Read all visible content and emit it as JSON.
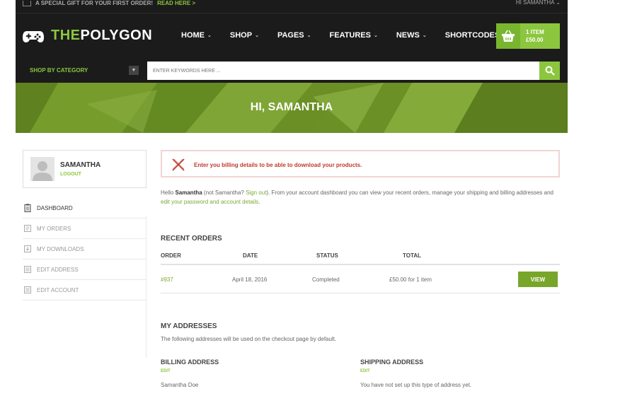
{
  "topbar": {
    "promo": "A SPECIAL GIFT FOR YOUR FIRST ORDER!",
    "promo_link": "READ HERE >",
    "account": "HI SAMANTHA",
    "account_chevron": "⌄"
  },
  "header": {
    "logo_the": "THE",
    "logo_rest": "POLYGON",
    "nav": [
      {
        "label": "HOME"
      },
      {
        "label": "SHOP"
      },
      {
        "label": "PAGES"
      },
      {
        "label": "FEATURES"
      },
      {
        "label": "NEWS"
      },
      {
        "label": "SHORTCODES"
      }
    ],
    "nav_chevron": "⌄",
    "cart": {
      "items": "1 ITEM",
      "total": "£50.00"
    }
  },
  "search": {
    "category_label": "SHOP BY CATEGORY",
    "placeholder": "ENTER KEYWORDS HERE ..."
  },
  "banner": {
    "title": "HI, SAMANTHA"
  },
  "profile": {
    "name": "SAMANTHA",
    "logout": "LOGOUT"
  },
  "menu": [
    {
      "label": "DASHBOARD",
      "icon": "clipboard-icon",
      "active": true
    },
    {
      "label": "MY ORDERS",
      "icon": "orders-icon",
      "active": false
    },
    {
      "label": "MY DOWNLOADS",
      "icon": "download-icon",
      "active": false
    },
    {
      "label": "EDIT ADDRESS",
      "icon": "address-icon",
      "active": false
    },
    {
      "label": "EDIT ACCOUNT",
      "icon": "account-icon",
      "active": false
    }
  ],
  "alert": {
    "message": "Enter you billing details to be able to download your products."
  },
  "intro": {
    "hello": "Hello ",
    "name": "Samantha",
    "not": " (not Samantha? ",
    "signout": "Sign out",
    "rest": "). From your account dashboard you can view your recent orders, manage your shipping and billing addresses and ",
    "edit_link": "edit your password and account details",
    "end": "."
  },
  "recent_orders": {
    "title": "RECENT ORDERS",
    "columns": [
      "ORDER",
      "DATE",
      "STATUS",
      "TOTAL"
    ],
    "rows": [
      {
        "order": "#937",
        "date": "April 18, 2016",
        "status": "Completed",
        "total": "£50.00 for 1 item",
        "action": "VIEW"
      }
    ]
  },
  "addresses": {
    "title": "MY ADDRESSES",
    "note": "The following addresses will be used on the checkout page by default.",
    "billing": {
      "title": "BILLING ADDRESS",
      "edit": "EDIT",
      "value": "Samantha Doe"
    },
    "shipping": {
      "title": "SHIPPING ADDRESS",
      "edit": "EDIT",
      "value": "You have not set up this type of address yet."
    }
  },
  "colors": {
    "accent": "#8cc63f",
    "dark": "#1b1b1b",
    "alert": "#c0392b"
  }
}
